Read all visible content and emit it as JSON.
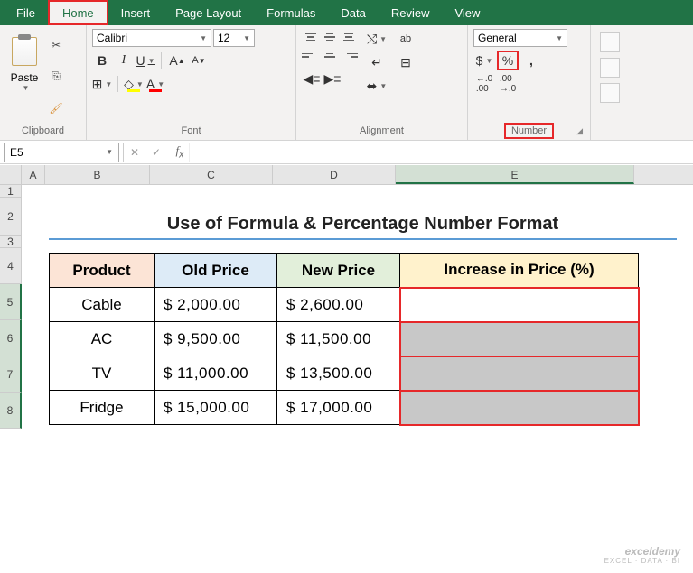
{
  "tabs": [
    "File",
    "Home",
    "Insert",
    "Page Layout",
    "Formulas",
    "Data",
    "Review",
    "View"
  ],
  "active_tab": "Home",
  "ribbon": {
    "clipboard": {
      "label": "Clipboard",
      "paste": "Paste"
    },
    "font": {
      "label": "Font",
      "name": "Calibri",
      "size": "12",
      "bold": "B",
      "italic": "I",
      "underline": "U"
    },
    "alignment": {
      "label": "Alignment"
    },
    "number": {
      "label": "Number",
      "format": "General",
      "currency": "$",
      "percent": "%",
      "comma": ",",
      "inc": ".0",
      "dec": ".00"
    }
  },
  "namebox": "E5",
  "cols": {
    "A": 26,
    "B": 116,
    "C": 136,
    "D": 136,
    "E": 264
  },
  "rows": [
    14,
    40,
    14,
    40,
    40,
    40,
    40,
    40
  ],
  "title": "Use of Formula & Percentage Number Format",
  "headers": {
    "b": "Product",
    "c": "Old Price",
    "d": "New Price",
    "e": "Increase in Price (%)"
  },
  "data": [
    {
      "product": "Cable",
      "old": "$   2,000.00",
      "new": "$   2,600.00"
    },
    {
      "product": "AC",
      "old": "$   9,500.00",
      "new": "$ 11,500.00"
    },
    {
      "product": "TV",
      "old": "$ 11,000.00",
      "new": "$ 13,500.00"
    },
    {
      "product": "Fridge",
      "old": "$ 15,000.00",
      "new": "$ 17,000.00"
    }
  ],
  "watermark": {
    "main": "exceldemy",
    "sub": "EXCEL · DATA · BI"
  }
}
